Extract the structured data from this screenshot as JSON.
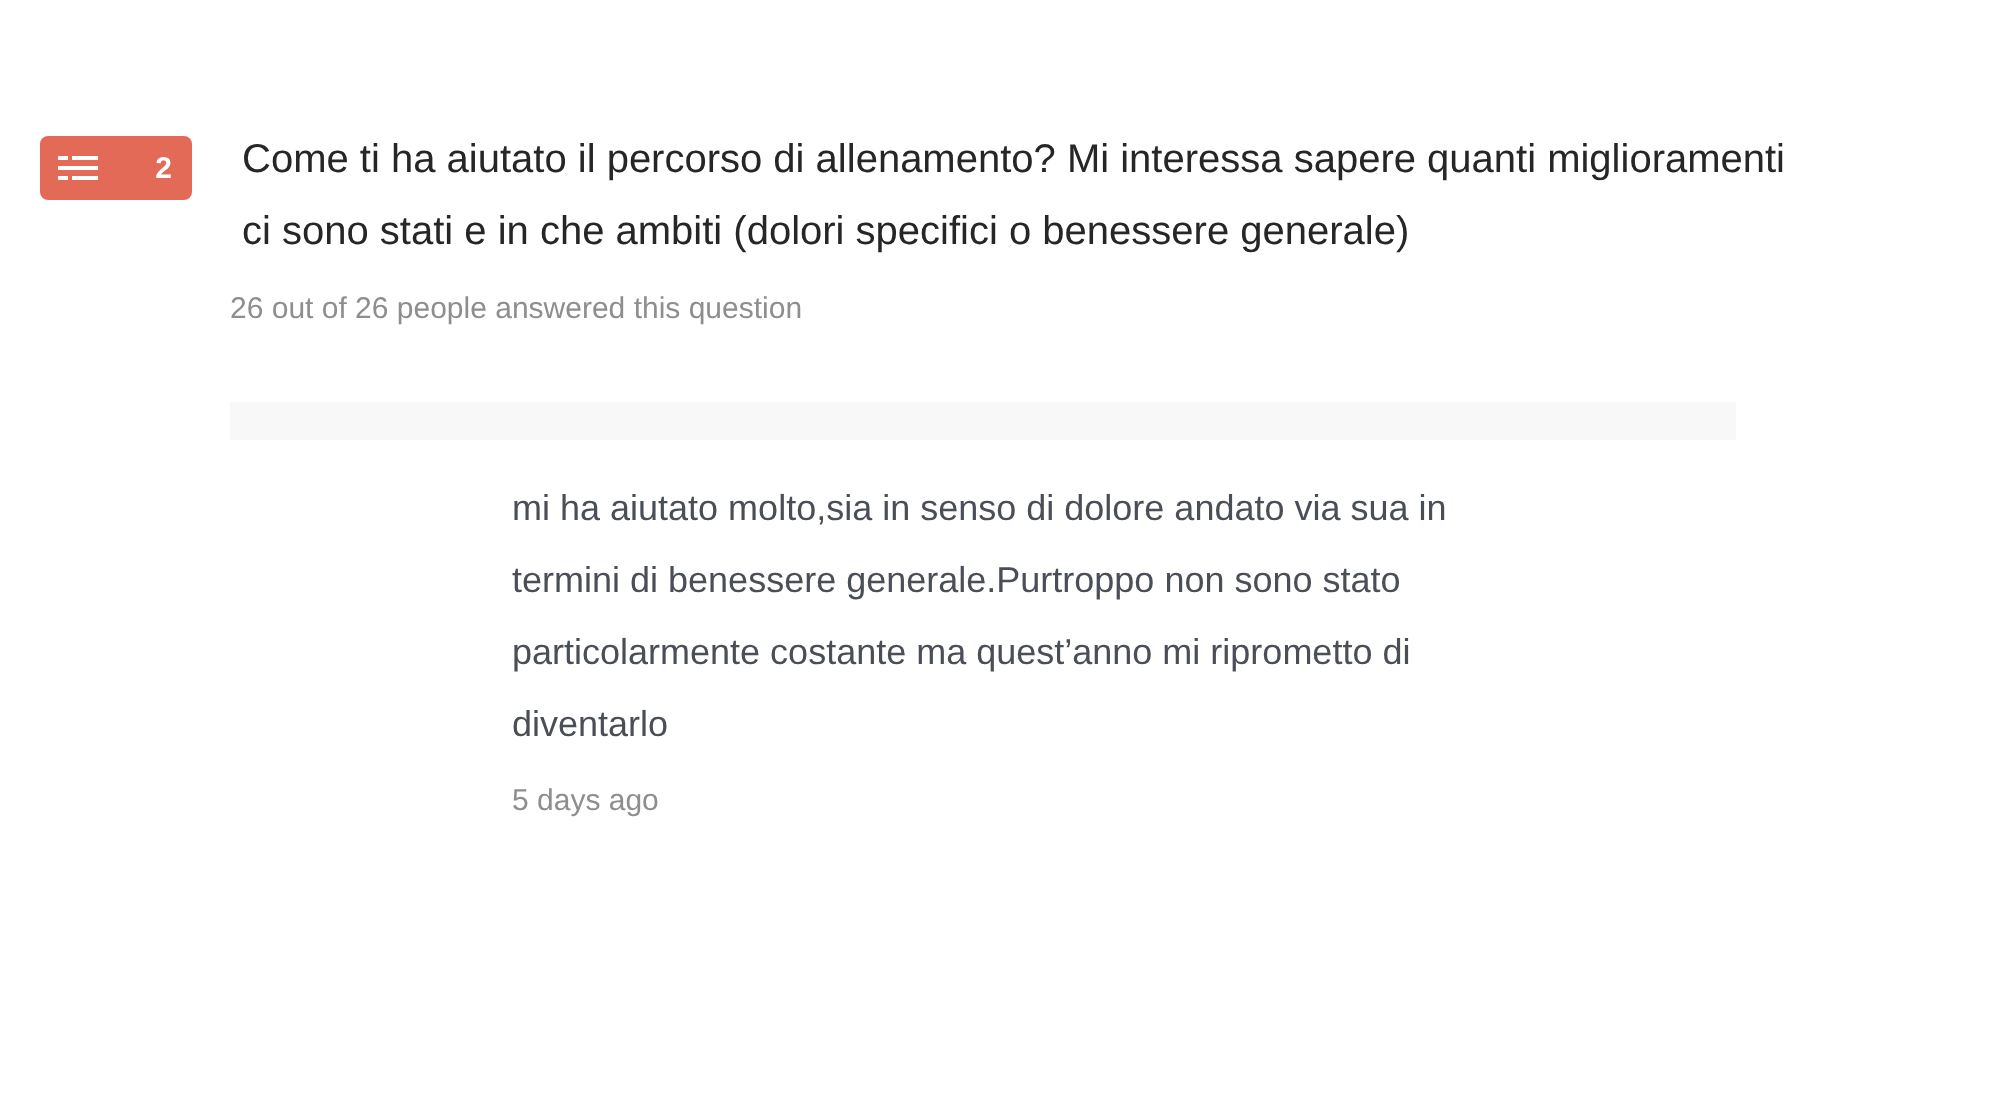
{
  "question": {
    "number": "2",
    "text": "Come ti ha aiutato il percorso di allenamento? Mi interessa sapere quanti miglioramenti ci sono stati e in che ambiti (dolori specifici o benessere generale)",
    "answered": "26 out of 26 people answered this question"
  },
  "answers": [
    {
      "text": "mi ha aiutato molto,sia in senso di dolore andato via sua in termini di benessere generale.Purtroppo non sono stato particolarmente costante ma quest’anno mi riprometto di diventarlo",
      "time": "5 days ago"
    }
  ]
}
